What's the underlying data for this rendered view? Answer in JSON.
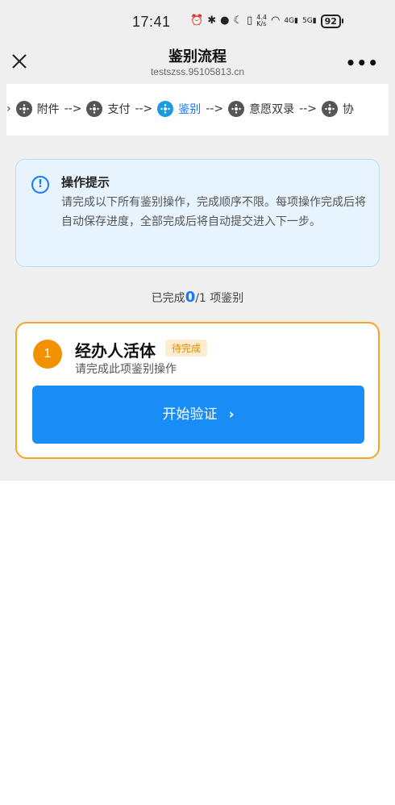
{
  "status_bar": {
    "time": "17:41",
    "net_speed": "4.4",
    "net_speed_unit": "K/s",
    "signal_1": "4G",
    "signal_2": "5G",
    "battery": "92"
  },
  "nav": {
    "title": "鉴别流程",
    "subtitle": "testszss.95105813.cn",
    "more_label": "•••"
  },
  "steps": [
    {
      "label": "附件",
      "active": false
    },
    {
      "label": "支付",
      "active": false
    },
    {
      "label": "鉴别",
      "active": true
    },
    {
      "label": "意愿双录",
      "active": false
    },
    {
      "label": "协",
      "active": false
    }
  ],
  "step_separator": "-->",
  "tip": {
    "icon": "!",
    "title": "操作提示",
    "text": "请完成以下所有鉴别操作，完成顺序不限。每项操作完成后将自动保存进度，全部完成后将自动提交进入下一步。"
  },
  "progress": {
    "prefix": "已完成",
    "done": "0",
    "suffix": "/1 项鉴别"
  },
  "task": {
    "number": "1",
    "title": "经办人活体",
    "badge": "待完成",
    "subtitle": "请完成此项鉴别操作",
    "button_label": "开始验证",
    "button_chevron": "›"
  },
  "colors": {
    "accent": "#1677ff",
    "button": "#1a8cf5",
    "card_border": "#f5a623",
    "badge_bg": "#fdecd0",
    "badge_text": "#e08a00",
    "tip_bg": "#e8f4fd"
  }
}
